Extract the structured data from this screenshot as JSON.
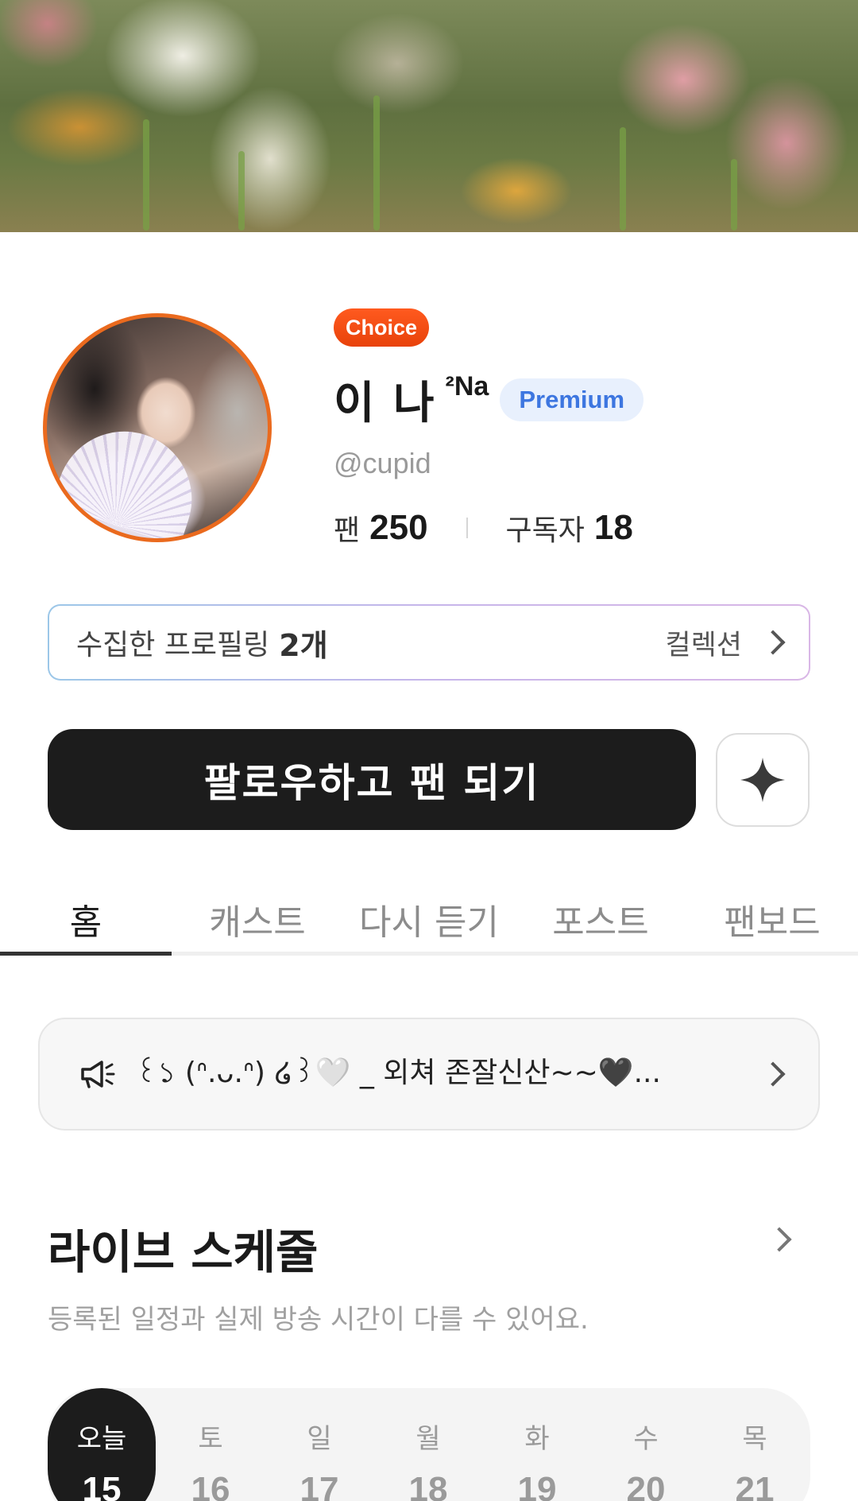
{
  "profile": {
    "badge": "Choice",
    "name": "이 나",
    "name_suffix": "²Na",
    "tier": "Premium",
    "handle": "@cupid",
    "stats": [
      {
        "label": "팬",
        "value": "250"
      },
      {
        "label": "구독자",
        "value": "18"
      }
    ]
  },
  "collection": {
    "label": "수집한 프로필링",
    "count": "2개",
    "link": "컬렉션"
  },
  "actions": {
    "follow_label": "팔로우하고 팬 되기"
  },
  "tabs": [
    {
      "label": "홈",
      "active": true
    },
    {
      "label": "캐스트",
      "active": false
    },
    {
      "label": "다시 듣기",
      "active": false
    },
    {
      "label": "포스트",
      "active": false
    },
    {
      "label": "팬보드",
      "active": false
    }
  ],
  "notice": {
    "icon": "megaphone-icon",
    "text": "꒰১ (ᐢ.ᴗ.ᐢ) ໒꒱🤍 _ 외쳐 존잘신산~~🖤..."
  },
  "schedule": {
    "title": "라이브 스케줄",
    "subtitle": "등록된 일정과 실제 방송 시간이 다를 수 있어요.",
    "days": [
      {
        "weekday": "오늘",
        "date": "15",
        "today": true
      },
      {
        "weekday": "토",
        "date": "16",
        "today": false
      },
      {
        "weekday": "일",
        "date": "17",
        "today": false
      },
      {
        "weekday": "월",
        "date": "18",
        "today": false
      },
      {
        "weekday": "화",
        "date": "19",
        "today": false
      },
      {
        "weekday": "수",
        "date": "20",
        "today": false
      },
      {
        "weekday": "목",
        "date": "21",
        "today": false
      }
    ]
  },
  "colors": {
    "accent_orange": "#ea6a1e",
    "premium_blue": "#3d76e0",
    "dark_button": "#1c1c1c"
  }
}
